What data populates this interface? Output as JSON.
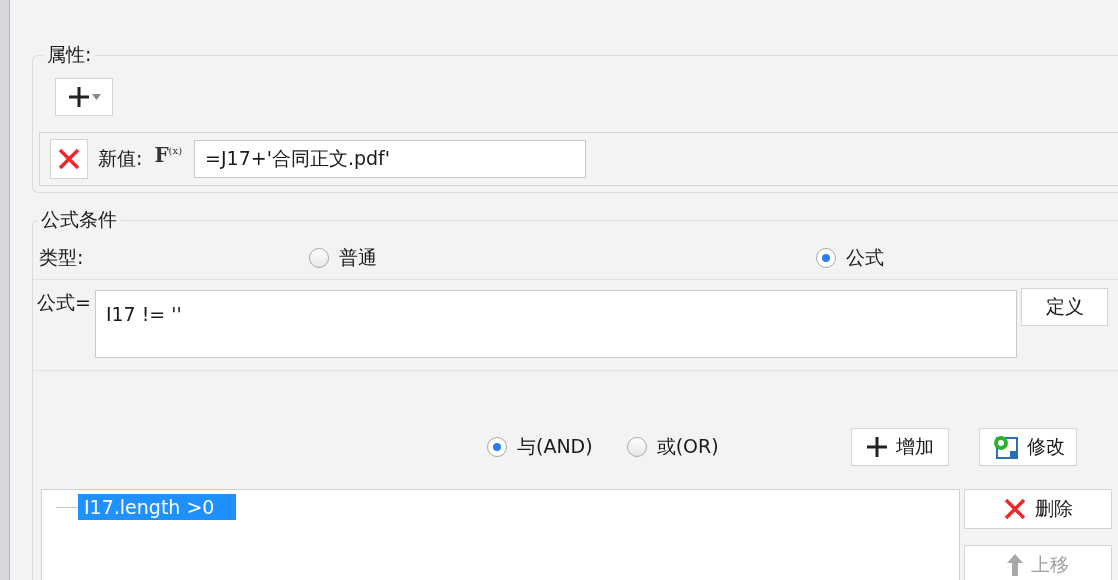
{
  "properties": {
    "title": "属性:",
    "rows": [
      {
        "label": "新值:",
        "function_letter": "F",
        "function_arg": "(x)",
        "value": "=J17+'合同正文.pdf'"
      }
    ]
  },
  "condition": {
    "title": "公式条件",
    "type_label": "类型:",
    "types": [
      {
        "label": "普通",
        "selected": false
      },
      {
        "label": "公式",
        "selected": true
      }
    ],
    "formula_label": "公式=",
    "formula": "I17 != ''",
    "define_button": "定义",
    "logic": [
      {
        "label": "与(AND)",
        "selected": true
      },
      {
        "label": "或(OR)",
        "selected": false
      }
    ],
    "buttons": [
      {
        "kind": "add",
        "label": "增加"
      },
      {
        "kind": "edit",
        "label": "修改"
      }
    ],
    "items": [
      {
        "text": "I17.length >0",
        "selected": true
      }
    ],
    "side_buttons": [
      {
        "kind": "delete",
        "label": "删除",
        "disabled": false
      },
      {
        "kind": "up",
        "label": "上移",
        "disabled": true
      }
    ]
  }
}
